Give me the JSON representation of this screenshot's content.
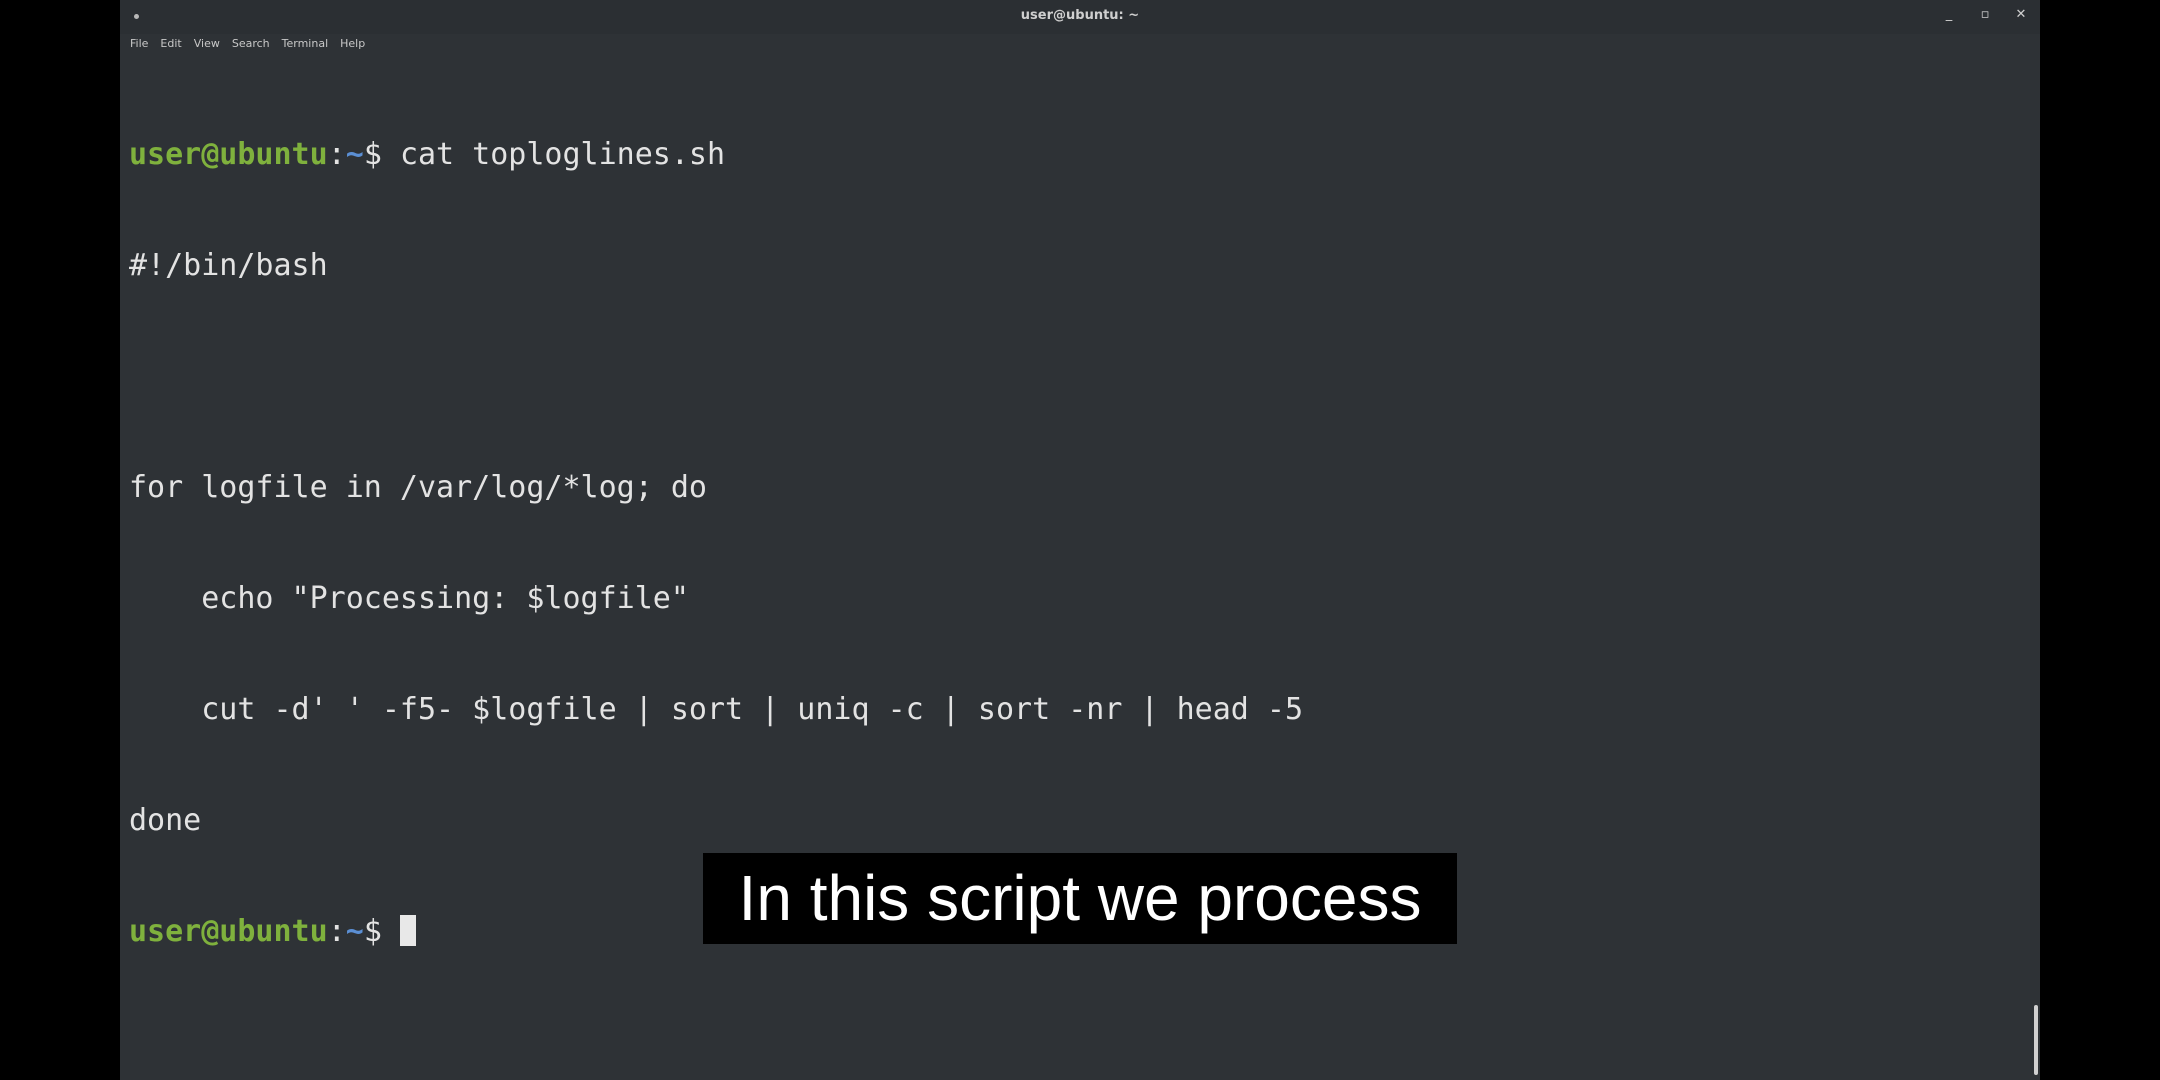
{
  "window": {
    "title": "user@ubuntu: ~",
    "controls": {
      "minimize": "_",
      "maximize": "▫",
      "close": "✕"
    }
  },
  "menu": [
    "File",
    "Edit",
    "View",
    "Search",
    "Terminal",
    "Help"
  ],
  "terminal": {
    "prompt": {
      "user_host": "user@ubuntu",
      "colon": ":",
      "path": "~",
      "symbol": "$ "
    },
    "command": "cat toploglines.sh",
    "output": [
      "#!/bin/bash",
      "",
      "for logfile in /var/log/*log; do",
      "    echo \"Processing: $logfile\"",
      "    cut -d' ' -f5- $logfile | sort | uniq -c | sort -nr | head -5",
      "done"
    ]
  },
  "caption": "In this script we process",
  "colors": {
    "terminal_bg": "#2e3236",
    "prompt_user": "#7fb13d",
    "prompt_path": "#5b8fd4",
    "text": "#e3e3e3"
  }
}
